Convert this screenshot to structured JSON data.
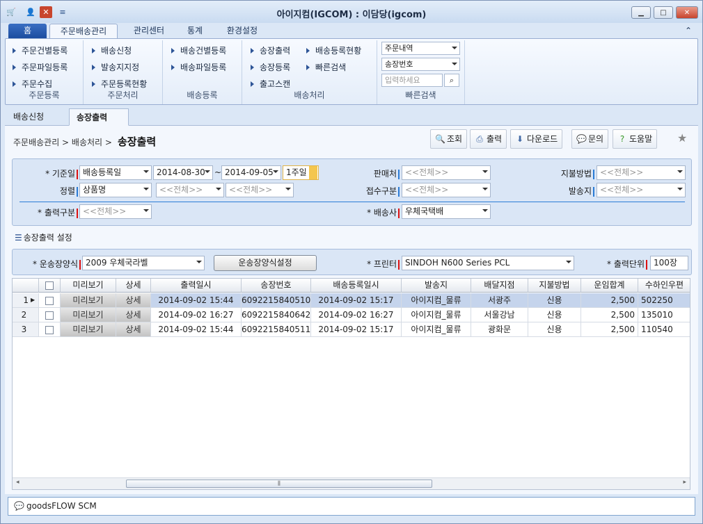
{
  "window": {
    "title": "아이지컴(IGCOM) : 이담당(igcom)"
  },
  "ribbon_tabs": [
    "홈",
    "주문배송관리",
    "관리센터",
    "통계",
    "환경설정"
  ],
  "ribbon": {
    "g1": {
      "items": [
        "주문건별등록",
        "주문파일등록",
        "주문수집"
      ],
      "label": "주문등록"
    },
    "g2": {
      "items": [
        "배송신청",
        "발송지지정",
        "주문등록현황"
      ],
      "label": "주문처리"
    },
    "g3": {
      "items": [
        "배송건별등록",
        "배송파일등록"
      ],
      "label": "배송등록"
    },
    "g4": {
      "items": [
        "송장출력",
        "송장등록",
        "출고스캔",
        "배송등록현황",
        "빠른검색"
      ],
      "label": "배송처리"
    },
    "g5": {
      "select1": "주문내역",
      "select2": "송장번호",
      "input_placeholder": "입력하세요",
      "label": "빠른검색"
    }
  },
  "doc_tabs": {
    "tab1": "배송신청",
    "tab2": "송장출력"
  },
  "breadcrumb": {
    "path": "주문배송관리 > 배송처리 >",
    "current": "송장출력"
  },
  "toolbar": {
    "search": "조회",
    "print": "출력",
    "download": "다운로드",
    "inquiry": "문의",
    "help": "도움말"
  },
  "filters": {
    "base_date_label": "* 기준일",
    "base_date_type": "배송등록일",
    "date_from": "2014-08-30",
    "date_sep": "~",
    "date_to": "2014-09-05",
    "period": "1주일",
    "seller_label": "판매처",
    "seller": "<<전체>>",
    "payment_label": "지불방법",
    "payment": "<<전체>>",
    "sort_label": "정렬",
    "sort1": "상품명",
    "sort2": "<<전체>>",
    "sort3": "<<전체>>",
    "receipt_label": "접수구분",
    "receipt": "<<전체>>",
    "origin_label": "발송지",
    "origin": "<<전체>>",
    "print_type_label": "* 출력구분",
    "print_type": "<<전체>>",
    "carrier_label": "* 배송사",
    "carrier": "우체국택배"
  },
  "settings": {
    "section_title": "송장출력 설정",
    "waybill_label": "* 운송장양식",
    "waybill": "2009 우체국라벨",
    "waybill_btn": "운송장양식설정",
    "printer_label": "* 프린터",
    "printer": "SINDOH N600 Series PCL",
    "unit_label": "* 출력단위",
    "unit": "100장"
  },
  "grid": {
    "columns": [
      "미리보기",
      "상세",
      "출력일시",
      "송장번호",
      "배송등록일시",
      "발송지",
      "배달지점",
      "지불방법",
      "운임합계",
      "수하인우편"
    ],
    "rows": [
      {
        "num": "1",
        "preview": "미리보기",
        "detail": "상세",
        "printed": "2014-09-02 15:44",
        "waybill": "6092215840510",
        "registered": "2014-09-02 15:17",
        "origin": "아이지컴_물류",
        "branch": "서광주",
        "payment": "신용",
        "fee": "2,500",
        "zip": "502250"
      },
      {
        "num": "2",
        "preview": "미리보기",
        "detail": "상세",
        "printed": "2014-09-02 16:27",
        "waybill": "6092215840642",
        "registered": "2014-09-02 16:27",
        "origin": "아이지컴_물류",
        "branch": "서울강남",
        "payment": "신용",
        "fee": "2,500",
        "zip": "135010"
      },
      {
        "num": "3",
        "preview": "미리보기",
        "detail": "상세",
        "printed": "2014-09-02 15:44",
        "waybill": "6092215840511",
        "registered": "2014-09-02 15:17",
        "origin": "아이지컴_물류",
        "branch": "광화문",
        "payment": "신용",
        "fee": "2,500",
        "zip": "110540"
      }
    ]
  },
  "status": {
    "text": "goodsFLOW SCM"
  },
  "colors": {
    "accent": "#1c4d9f",
    "selected_row": "#c5d4ec",
    "required_mark": "#dd1111"
  }
}
